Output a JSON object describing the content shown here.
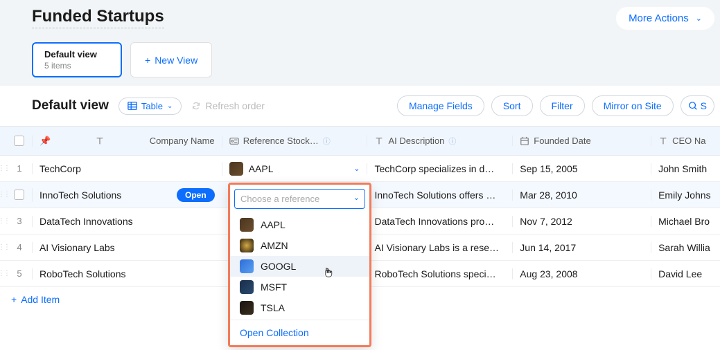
{
  "header": {
    "title": "Funded Startups",
    "more_actions": "More Actions"
  },
  "views": {
    "active": {
      "title": "Default view",
      "subtitle": "5 items"
    },
    "new_view_label": "New View"
  },
  "toolbar": {
    "view_name": "Default view",
    "table_label": "Table",
    "refresh_label": "Refresh order",
    "manage_fields": "Manage Fields",
    "sort": "Sort",
    "filter": "Filter",
    "mirror": "Mirror on Site",
    "search_label": "S"
  },
  "columns": {
    "company": "Company Name",
    "reference": "Reference Stock…",
    "description": "AI Description",
    "founded": "Founded Date",
    "ceo": "CEO Na"
  },
  "rows": [
    {
      "num": "1",
      "company": "TechCorp",
      "ref_ticker": "AAPL",
      "ref_icon": "aapl",
      "desc": "TechCorp specializes in d…",
      "founded": "Sep 15, 2005",
      "ceo": "John Smith",
      "selected": false
    },
    {
      "num": "",
      "company": "InnoTech Solutions",
      "ref_ticker": "",
      "ref_icon": "",
      "desc": "InnoTech Solutions offers …",
      "founded": "Mar 28, 2010",
      "ceo": "Emily Johns",
      "selected": true,
      "open_badge": "Open"
    },
    {
      "num": "3",
      "company": "DataTech Innovations",
      "ref_ticker": "",
      "ref_icon": "",
      "desc": "DataTech Innovations pro…",
      "founded": "Nov 7, 2012",
      "ceo": "Michael Bro",
      "selected": false
    },
    {
      "num": "4",
      "company": "AI Visionary Labs",
      "ref_ticker": "",
      "ref_icon": "",
      "desc": "AI Visionary Labs is a rese…",
      "founded": "Jun 14, 2017",
      "ceo": "Sarah Willia",
      "selected": false
    },
    {
      "num": "5",
      "company": "RoboTech Solutions",
      "ref_ticker": "",
      "ref_icon": "",
      "desc": "RoboTech Solutions speci…",
      "founded": "Aug 23, 2008",
      "ceo": "David Lee",
      "selected": false
    }
  ],
  "add_item": "Add Item",
  "dropdown": {
    "placeholder": "Choose a reference",
    "options": [
      {
        "ticker": "AAPL",
        "icon": "aapl"
      },
      {
        "ticker": "AMZN",
        "icon": "amzn"
      },
      {
        "ticker": "GOOGL",
        "icon": "googl",
        "hover": true
      },
      {
        "ticker": "MSFT",
        "icon": "msft"
      },
      {
        "ticker": "TSLA",
        "icon": "tsla"
      }
    ],
    "footer": "Open Collection"
  }
}
